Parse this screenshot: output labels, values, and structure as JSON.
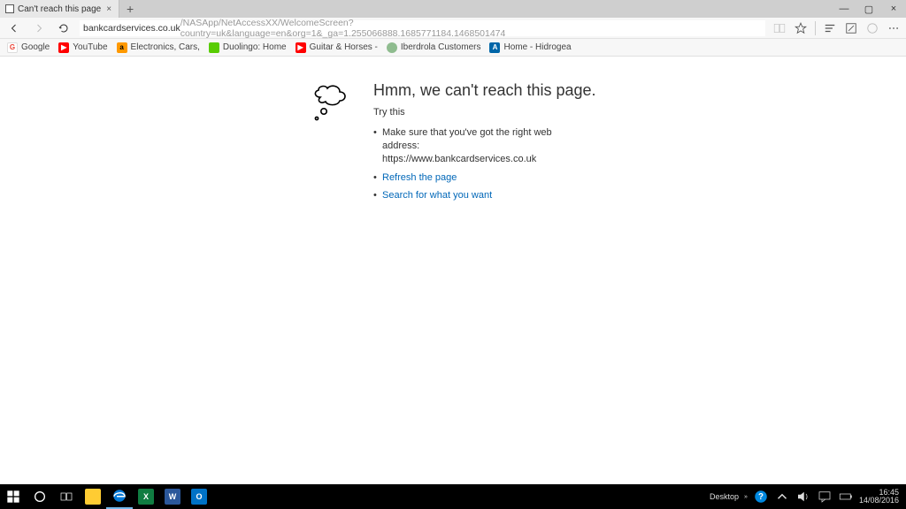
{
  "titlebar": {
    "tab_title": "Can't reach this page",
    "tab_close": "×",
    "new_tab": "+",
    "min": "—",
    "max": "▢",
    "close": "×"
  },
  "toolbar": {
    "url_display": "bankcardservices.co.uk",
    "url_rest": "/NASApp/NetAccessXX/WelcomeScreen?country=uk&language=en&org=1&_ga=1.255066888.1685771184.1468501474"
  },
  "favorites": [
    {
      "label": "Google"
    },
    {
      "label": "YouTube"
    },
    {
      "label": "Electronics, Cars,"
    },
    {
      "label": "Duolingo: Home"
    },
    {
      "label": "Guitar & Horses -"
    },
    {
      "label": "Iberdrola Customers"
    },
    {
      "label": "Home - Hidrogea"
    }
  ],
  "error": {
    "heading": "Hmm, we can't reach this page.",
    "try_label": "Try this",
    "bullet1a": "Make sure that you've got the right web address:",
    "bullet1b": "https://www.bankcardservices.co.uk",
    "bullet2": "Refresh the page",
    "bullet3": "Search for what you want"
  },
  "taskbar": {
    "desktop_label": "Desktop",
    "time": "16:45",
    "date": "14/08/2016",
    "apps": {
      "excel": "X",
      "word": "W",
      "outlook": "O"
    }
  }
}
